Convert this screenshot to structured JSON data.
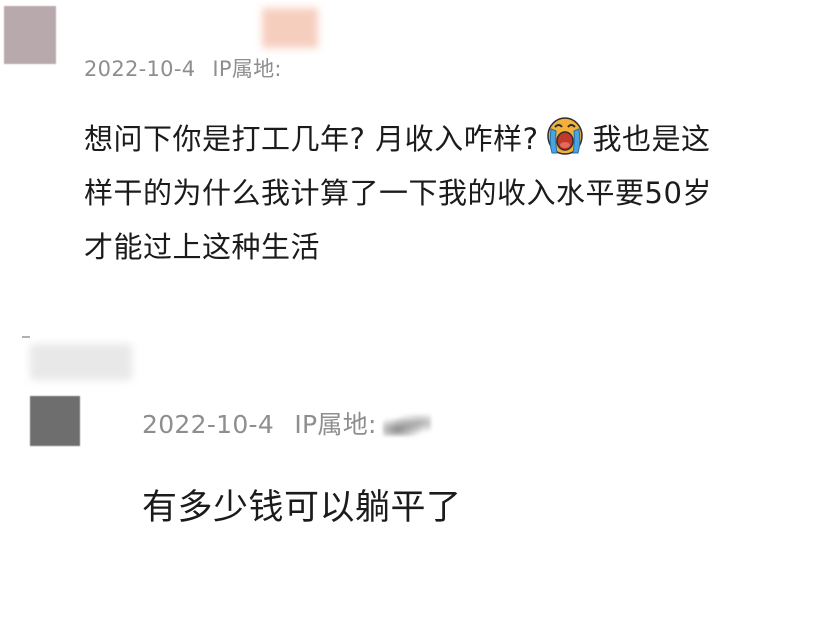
{
  "comments": [
    {
      "date": "2022-10-4",
      "ip_label": "IP属地:",
      "text_line1a": "想问下你是打工几年? 月收入咋样?",
      "emoji": "crying-face-icon",
      "text_line1b": "我也是这",
      "text_line2": "样干的为什么我计算了一下我的收入水平要50岁",
      "text_line3": "才能过上这种生活"
    },
    {
      "date": "2022-10-4",
      "ip_label": "IP属地:",
      "text": "有多少钱可以躺平了"
    }
  ],
  "colors": {
    "avatar1": "#b8a9ac",
    "name_blur1": "#f6c9b8",
    "avatar2": "#6e6e6e",
    "meta_text": "#8e8e8e",
    "content_text": "#1b1b1b"
  }
}
